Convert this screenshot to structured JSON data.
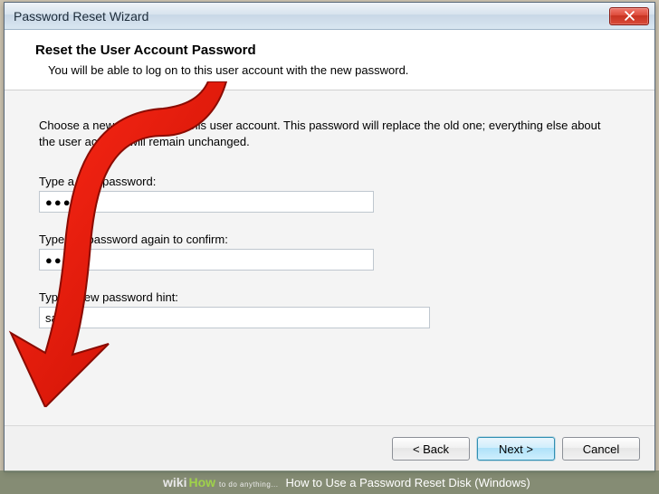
{
  "window": {
    "title": "Password Reset Wizard"
  },
  "header": {
    "heading": "Reset the User Account Password",
    "subtitle": "You will be able to log on to this user account with the new password."
  },
  "content": {
    "instruction": "Choose a new password for this user account. This password will replace the old one; everything else about the user account will remain unchanged.",
    "new_password_label": "Type a new password:",
    "new_password_value": "●●●●",
    "confirm_label": "Type the password again to confirm:",
    "confirm_value": "●●●●",
    "hint_label": "Type a new password hint:",
    "hint_value": "same"
  },
  "buttons": {
    "back": "< Back",
    "next": "Next >",
    "cancel": "Cancel"
  },
  "watermark": {
    "wiki": "wiki",
    "how": "How",
    "tagline": "to do anything...",
    "article": "How to Use a Password Reset Disk (Windows)"
  }
}
